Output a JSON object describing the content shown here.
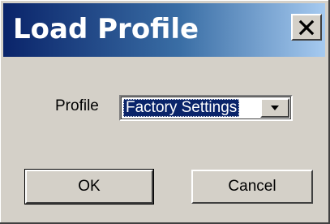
{
  "window": {
    "title": "Load Profile",
    "close_icon": "close-icon"
  },
  "form": {
    "profile_label": "Profile",
    "profile_selected": "Factory Settings",
    "dropdown_icon": "chevron-down-icon"
  },
  "buttons": {
    "ok_label": "OK",
    "cancel_label": "Cancel"
  },
  "colors": {
    "title_start": "#0a246a",
    "title_end": "#a6caf0",
    "dialog_face": "#d4d0c8",
    "selection": "#0a246a"
  }
}
